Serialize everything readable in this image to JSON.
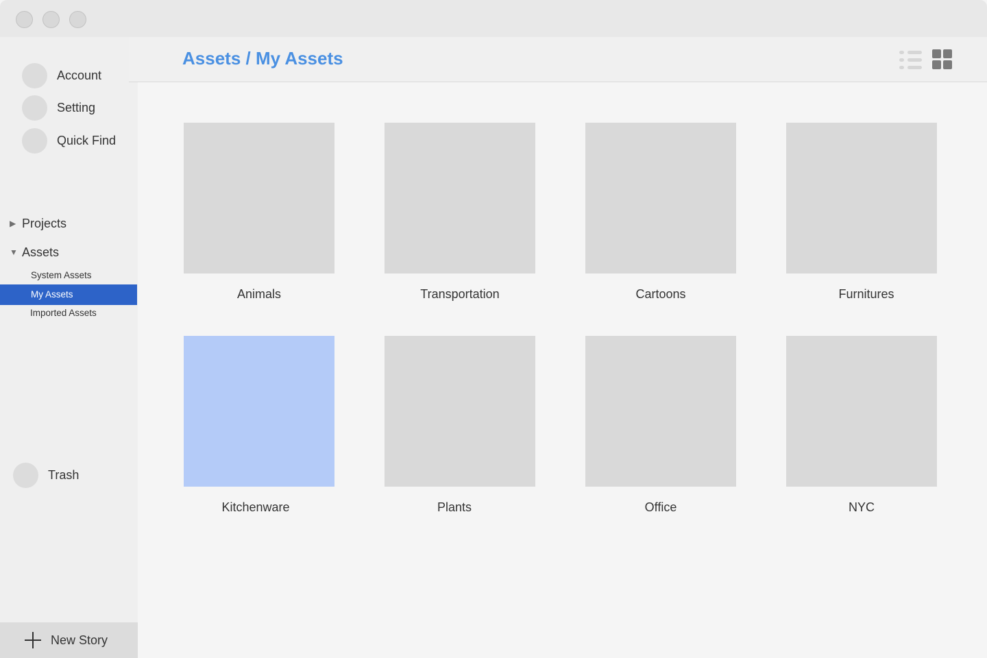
{
  "window": {
    "controls": [
      "close",
      "minimize",
      "zoom"
    ]
  },
  "sidebar": {
    "top_items": [
      {
        "label": "Account",
        "icon": "account-icon"
      },
      {
        "label": "Setting",
        "icon": "setting-icon"
      },
      {
        "label": "Quick Find",
        "icon": "quick-find-icon"
      }
    ],
    "projects": {
      "label": "Projects",
      "expanded": false
    },
    "assets": {
      "label": "Assets",
      "expanded": true,
      "children": [
        {
          "label": "System Assets",
          "selected": false
        },
        {
          "label": "My Assets",
          "selected": true
        },
        {
          "label": "Imported Assets",
          "selected": false
        }
      ]
    },
    "trash": {
      "label": "Trash",
      "icon": "trash-icon"
    },
    "new_story": {
      "label": "New Story",
      "icon": "plus-icon"
    }
  },
  "header": {
    "breadcrumb": "Assets / My Assets",
    "view_modes": [
      "list",
      "grid"
    ],
    "active_view": "grid"
  },
  "grid": {
    "items": [
      {
        "label": "Animals",
        "selected": false
      },
      {
        "label": "Transportation",
        "selected": false
      },
      {
        "label": "Cartoons",
        "selected": false
      },
      {
        "label": "Furnitures",
        "selected": false
      },
      {
        "label": "Kitchenware",
        "selected": true
      },
      {
        "label": "Plants",
        "selected": false
      },
      {
        "label": "Office",
        "selected": false
      },
      {
        "label": "NYC",
        "selected": false
      }
    ]
  },
  "colors": {
    "accent": "#4a90e2",
    "selection": "#2d63c8",
    "tile_selected": "#b4cbf8",
    "tile": "#d9d9d9"
  }
}
